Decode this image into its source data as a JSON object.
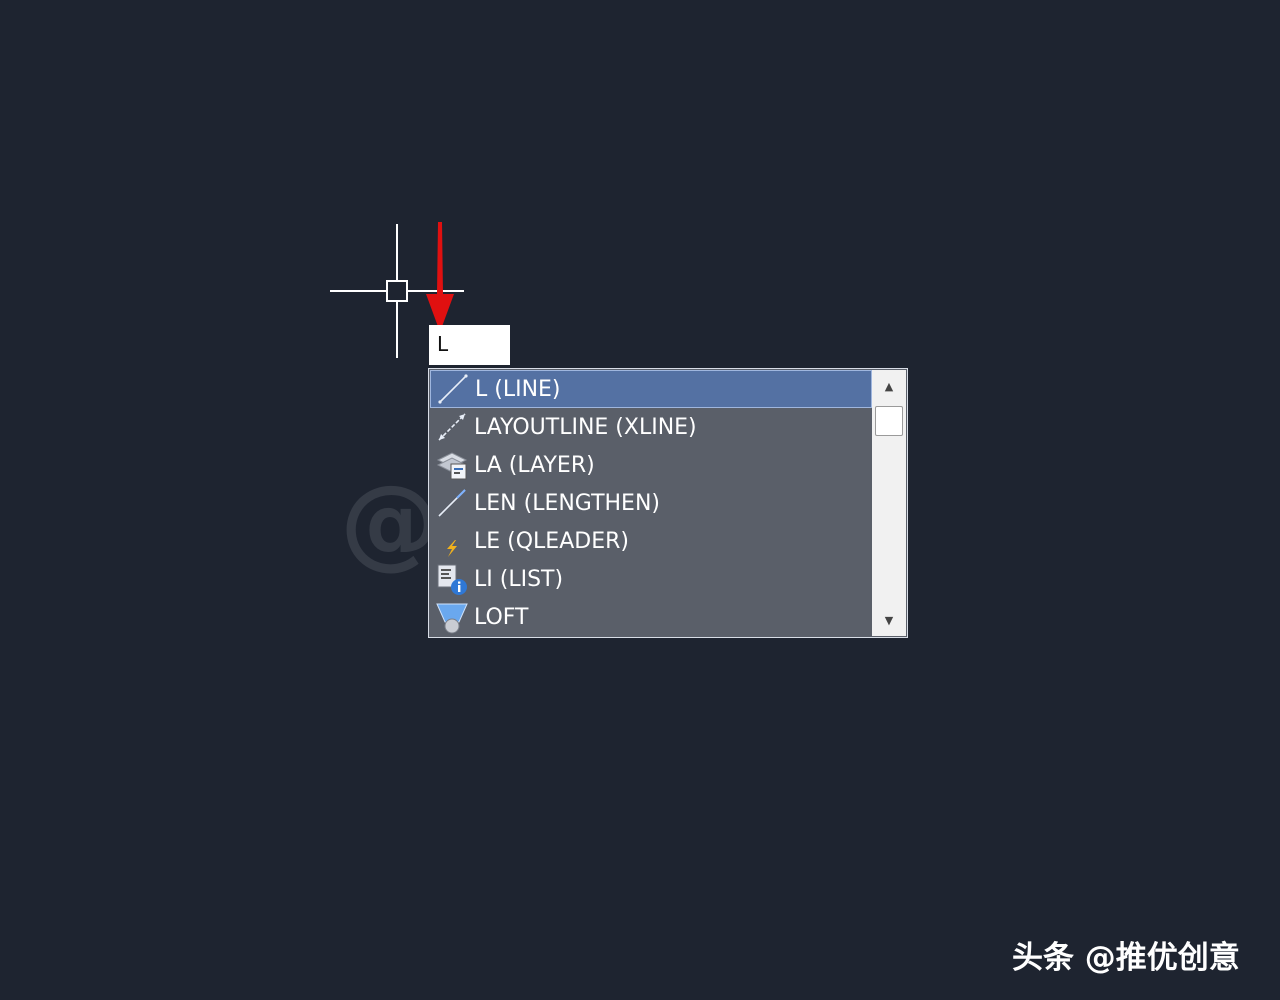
{
  "command_line": {
    "typed_value": "L"
  },
  "autocomplete": {
    "items": [
      {
        "label": "L (LINE)",
        "icon": "line-icon",
        "selected": true
      },
      {
        "label": "LAYOUTLINE (XLINE)",
        "icon": "xline-icon",
        "selected": false
      },
      {
        "label": "LA (LAYER)",
        "icon": "layer-icon",
        "selected": false
      },
      {
        "label": "LEN (LENGTHEN)",
        "icon": "lengthen-icon",
        "selected": false
      },
      {
        "label": "LE (QLEADER)",
        "icon": "qleader-icon",
        "selected": false
      },
      {
        "label": "LI (LIST)",
        "icon": "list-icon",
        "selected": false
      },
      {
        "label": "LOFT",
        "icon": "loft-icon",
        "selected": false
      }
    ],
    "scroll_up_glyph": "▲",
    "scroll_down_glyph": "▼"
  },
  "watermark": {
    "text": "@推优创意"
  },
  "credit": {
    "text": "头条 @推优创意"
  },
  "colors": {
    "canvas_background": "#1e2430",
    "dropdown_background": "#5a5f69",
    "selected_item": "#5471a3",
    "arrow_annotation": "#e01010"
  }
}
